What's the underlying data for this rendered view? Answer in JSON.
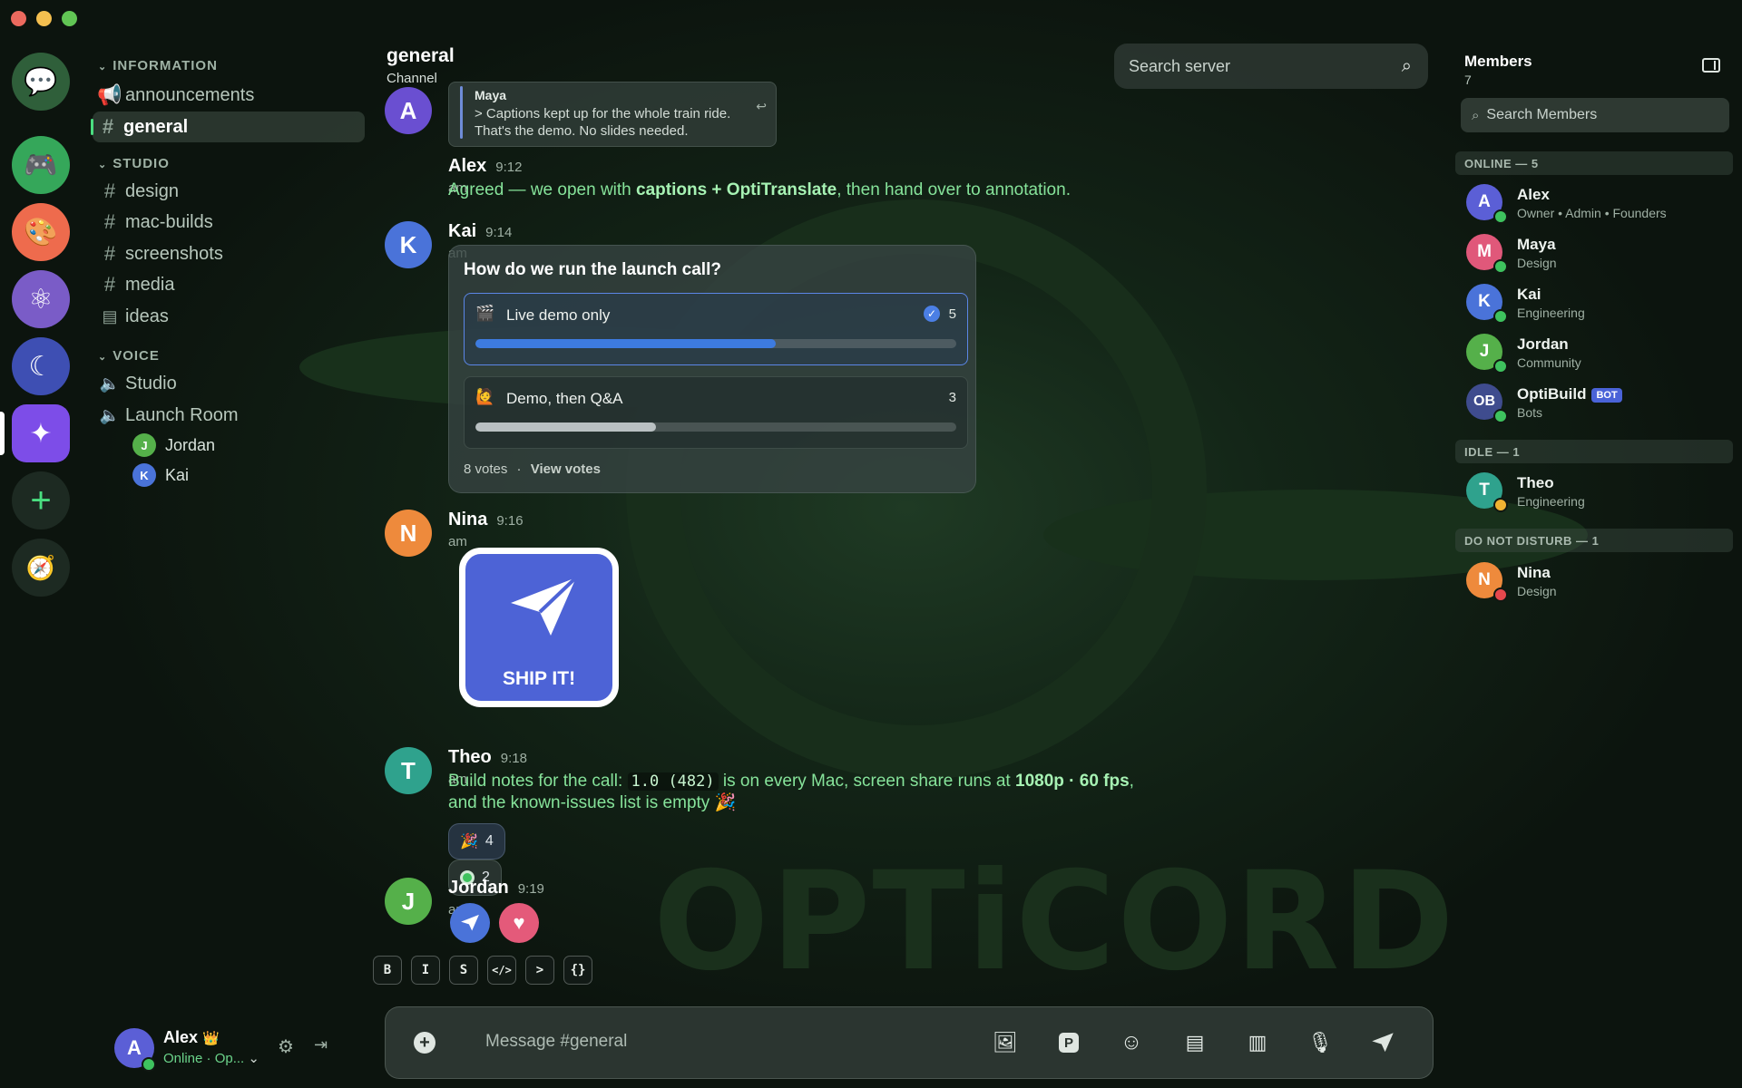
{
  "window": {
    "traffic_colors": [
      "#ec6a5e",
      "#f4bf4f",
      "#61c554"
    ]
  },
  "servers": [
    {
      "name": "chat-bubble-icon",
      "color": "#2f5f3a",
      "glyph": "💬"
    },
    {
      "name": "gamepad-icon",
      "color": "#35a75a",
      "glyph": "🎮"
    },
    {
      "name": "palette-icon",
      "color": "#ee6b4d",
      "glyph": "🎨"
    },
    {
      "name": "atom-icon",
      "color": "#7a5cc7",
      "glyph": "⚛"
    },
    {
      "name": "moon-icon",
      "color": "#3e4fb3",
      "glyph": "☾"
    },
    {
      "name": "sparkle-icon",
      "color": "#7d4de8",
      "glyph": "✦"
    },
    {
      "name": "add-server-icon",
      "color": "#1d2a22",
      "glyph": "+"
    },
    {
      "name": "compass-icon",
      "color": "#1d2a22",
      "glyph": "🧭"
    }
  ],
  "channels": {
    "categories": {
      "information": "INFORMATION",
      "studio": "STUDIO",
      "voice": "VOICE"
    },
    "information": [
      {
        "name": "announcements",
        "icon": "megaphone-icon"
      },
      {
        "name": "general",
        "icon": "hash-icon",
        "selected": true
      }
    ],
    "studio": [
      {
        "name": "design"
      },
      {
        "name": "mac-builds"
      },
      {
        "name": "screenshots"
      },
      {
        "name": "media"
      },
      {
        "name": "ideas",
        "icon": "forum-icon"
      }
    ],
    "voice": [
      {
        "name": "Studio"
      },
      {
        "name": "Launch Room"
      }
    ],
    "voice_users": [
      {
        "name": "Jordan",
        "initial": "J",
        "color": "#55b04a"
      },
      {
        "name": "Kai",
        "initial": "K",
        "color": "#4a73d9"
      }
    ]
  },
  "user_panel": {
    "name": "Alex",
    "initial": "A",
    "status": "Online · Op...",
    "crown": "👑"
  },
  "header": {
    "title": "general",
    "subtitle": "Channel",
    "search_placeholder": "Search server"
  },
  "messages": {
    "reply": {
      "author": "Maya",
      "initial": "A",
      "line1": "> Captions kept up for the whole train ride.",
      "line2": "That's the demo. No slides needed."
    },
    "alex": {
      "author": "Alex",
      "time": "9:12 am",
      "pre": "Agreed — we open with ",
      "bold": "captions + OptiTranslate",
      "post": ", then hand over to annotation."
    },
    "kai": {
      "author": "Kai",
      "initial": "K",
      "time": "9:14 am",
      "poll": {
        "question": "How do we run the launch call?",
        "options": [
          {
            "emoji": "🎬",
            "label": "Live demo only",
            "votes": "5",
            "fraction": 0.625,
            "color": "#3d7be0"
          },
          {
            "emoji": "🙋",
            "label": "Demo, then Q&A",
            "votes": "3",
            "fraction": 0.375,
            "color": "#b9c0c2"
          }
        ],
        "total": "8 votes",
        "sep": "·",
        "view": "View votes"
      }
    },
    "nina": {
      "author": "Nina",
      "initial": "N",
      "time": "9:16 am",
      "sticker_text": "SHIP IT!"
    },
    "theo": {
      "author": "Theo",
      "initial": "T",
      "time": "9:18 am",
      "pre": "Build notes for the call: ",
      "code": "1.0 (482)",
      "mid": " is on every Mac, screen share runs at ",
      "bold": "1080p · 60 fps",
      "post": ",",
      "line2": "and the known-issues list is empty 🎉",
      "reactions": [
        {
          "emoji": "🎉",
          "count": "4"
        },
        {
          "emoji": "🟢",
          "count": "2"
        }
      ]
    },
    "jordan": {
      "author": "Jordan",
      "initial": "J",
      "time": "9:19 am"
    }
  },
  "format_toolbar": [
    "B",
    "I",
    "S",
    "</>",
    ">",
    "{}"
  ],
  "composer": {
    "placeholder": "Message #general"
  },
  "members": {
    "title": "Members",
    "count": "7",
    "search_placeholder": "Search Members",
    "groups": {
      "online": "ONLINE — 5",
      "idle": "IDLE — 1",
      "dnd": "DO NOT DISTURB — 1"
    },
    "online": [
      {
        "name": "Alex",
        "initial": "A",
        "role": "Owner • Admin • Founders",
        "color": "#5b5fd6"
      },
      {
        "name": "Maya",
        "initial": "M",
        "role": "Design",
        "color": "#e0587a"
      },
      {
        "name": "Kai",
        "initial": "K",
        "role": "Engineering",
        "color": "#4a73d9"
      },
      {
        "name": "Jordan",
        "initial": "J",
        "role": "Community",
        "color": "#55b04a"
      },
      {
        "name": "OptiBuild",
        "initial": "OB",
        "role": "Bots",
        "color": "#3f4c8e",
        "bot": "BOT"
      }
    ],
    "idle": [
      {
        "name": "Theo",
        "initial": "T",
        "role": "Engineering",
        "color": "#2fa28d"
      }
    ],
    "dnd": [
      {
        "name": "Nina",
        "initial": "N",
        "role": "Design",
        "color": "#ee8a3c"
      }
    ]
  },
  "background": {
    "wordmark": "OPTiCORD"
  }
}
